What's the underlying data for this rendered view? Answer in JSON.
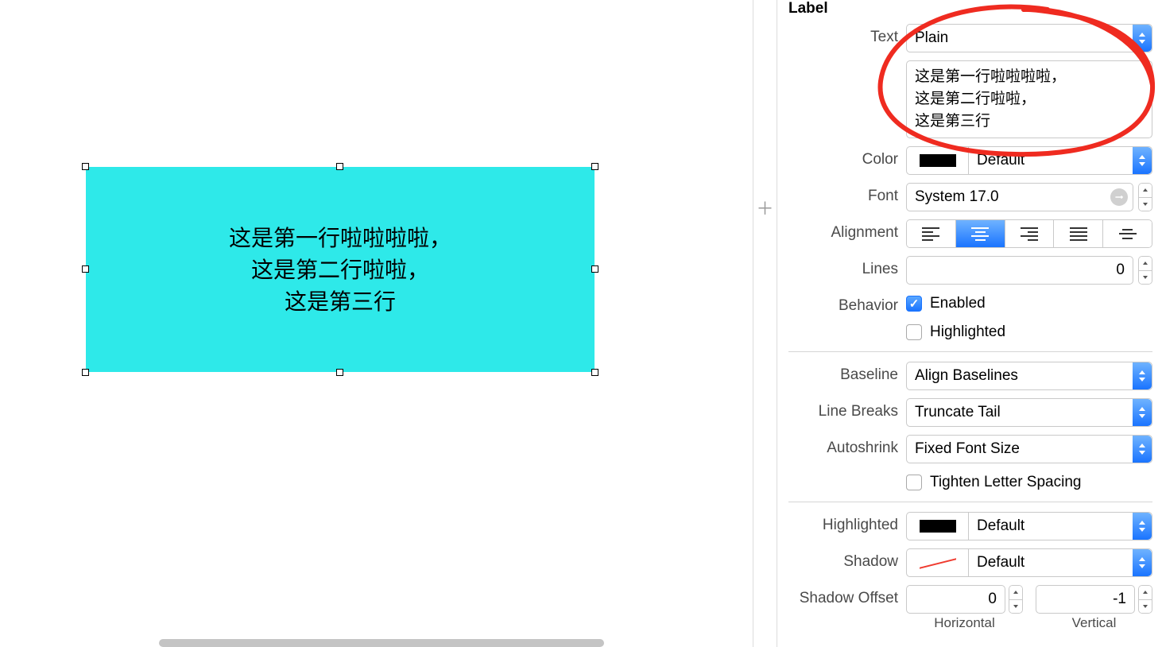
{
  "canvas": {
    "label_text": "这是第一行啦啦啦啦，\n这是第二行啦啦，\n这是第三行"
  },
  "inspector": {
    "section_title": "Label",
    "text_label": "Text",
    "text_type": "Plain",
    "text_value": "这是第一行啦啦啦啦，\n这是第二行啦啦，\n这是第三行",
    "color_label": "Color",
    "color_value": "Default",
    "font_label": "Font",
    "font_value": "System 17.0",
    "alignment_label": "Alignment",
    "lines_label": "Lines",
    "lines_value": "0",
    "behavior_label": "Behavior",
    "enabled_label": "Enabled",
    "highlighted_chk_label": "Highlighted",
    "baseline_label": "Baseline",
    "baseline_value": "Align Baselines",
    "linebreaks_label": "Line Breaks",
    "linebreaks_value": "Truncate Tail",
    "autoshrink_label": "Autoshrink",
    "autoshrink_value": "Fixed Font Size",
    "tighten_label": "Tighten Letter Spacing",
    "highlighted_label": "Highlighted",
    "highlighted_value": "Default",
    "shadow_label": "Shadow",
    "shadow_value": "Default",
    "shadow_offset_label": "Shadow Offset",
    "horizontal_value": "0",
    "horizontal_caption": "Horizontal",
    "vertical_value": "-1",
    "vertical_caption": "Vertical"
  }
}
